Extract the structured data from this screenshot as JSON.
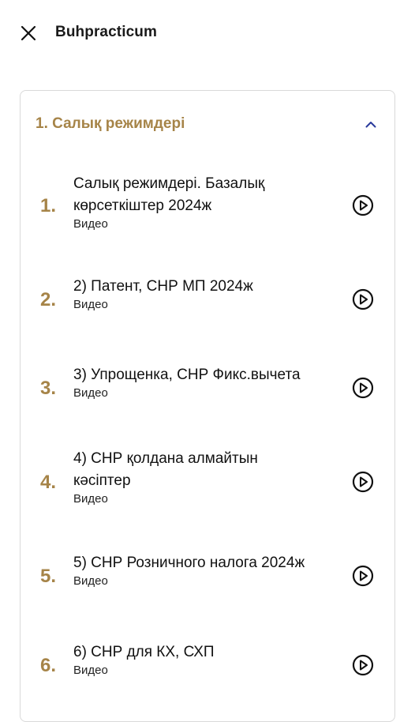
{
  "header": {
    "title": "Buhpracticum",
    "close_icon": "close-icon"
  },
  "section": {
    "title": "1. Салық режимдері",
    "expanded": true,
    "accent_color": "#a68448",
    "chevron_color": "#2a3a9c"
  },
  "lessons": [
    {
      "num": "1.",
      "title": "Салық режимдері. Базалық көрсеткіштер 2024ж",
      "type": "Видео",
      "icon": "play-icon"
    },
    {
      "num": "2.",
      "title": "2) Патент, СНР МП 2024ж",
      "type": "Видео",
      "icon": "play-icon"
    },
    {
      "num": "3.",
      "title": "3) Упрощенка, СНР Фикс.вычета",
      "type": "Видео",
      "icon": "play-icon"
    },
    {
      "num": "4.",
      "title": "4) СНР қолдана алмайтын кәсіптер",
      "type": "Видео",
      "icon": "play-icon"
    },
    {
      "num": "5.",
      "title": "5) СНР Розничного налога 2024ж",
      "type": "Видео",
      "icon": "play-icon"
    },
    {
      "num": "6.",
      "title": "6) СНР для КХ, СХП",
      "type": "Видео",
      "icon": "play-icon"
    }
  ]
}
